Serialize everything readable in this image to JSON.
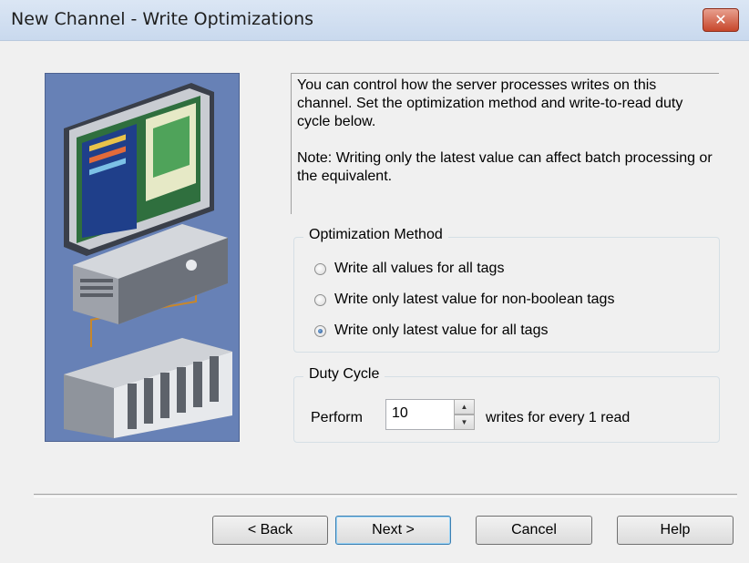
{
  "window": {
    "title": "New Channel - Write Optimizations",
    "close_glyph": "✕"
  },
  "description": {
    "line1": "You can control how the server processes writes on this channel.  Set the optimization method and write-to-read duty cycle below.",
    "note": "Note:  Writing only the latest value can affect batch processing or the equivalent."
  },
  "optimization": {
    "legend": "Optimization Method",
    "options": [
      {
        "label": "Write all values for all tags",
        "checked": false
      },
      {
        "label": "Write only latest value for non-boolean tags",
        "checked": false
      },
      {
        "label": "Write only latest value for all tags",
        "checked": true
      }
    ]
  },
  "duty_cycle": {
    "legend": "Duty Cycle",
    "prefix": "Perform",
    "value": "10",
    "suffix": "writes for every 1 read"
  },
  "buttons": {
    "back": "< Back",
    "next": "Next >",
    "cancel": "Cancel",
    "help": "Help"
  },
  "icons": {
    "close": "close-icon",
    "spin_up": "spin-up-icon",
    "spin_down": "spin-down-icon"
  }
}
